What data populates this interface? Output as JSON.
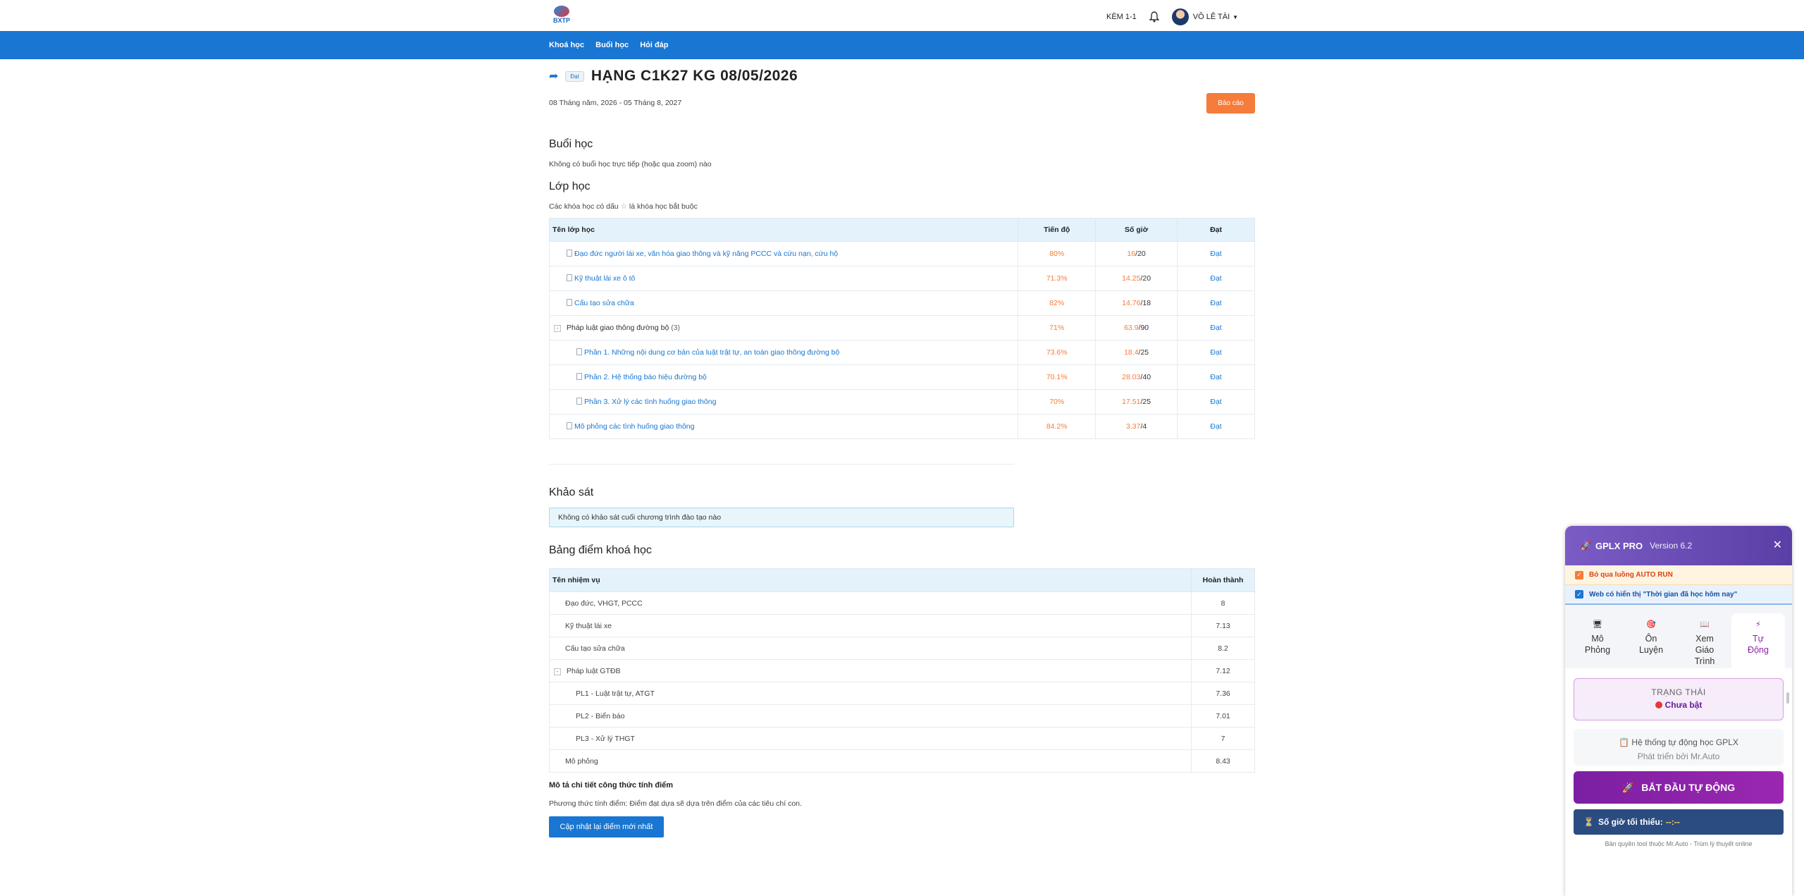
{
  "header": {
    "logo_text": "BXTP",
    "kem_label": "KÈM 1-1",
    "user_name": "VÕ LÊ TÀI"
  },
  "nav": [
    "Khoá học",
    "Buổi học",
    "Hỏi đáp"
  ],
  "course": {
    "status": "Đạt",
    "title": "HẠNG C1K27 KG 08/05/2026",
    "date_range": "08 Tháng năm, 2026 - 05 Tháng 8, 2027",
    "report_label": "Báo cáo"
  },
  "sessions": {
    "heading": "Buổi học",
    "note": "Không có buổi học trực tiếp (hoặc qua zoom) nào"
  },
  "classes": {
    "heading": "Lớp học",
    "note_before": "Các khóa học có dấu",
    "note_star": "☆",
    "note_after": "là khóa học bắt buộc",
    "columns": [
      "Tên lớp học",
      "Tiến độ",
      "Số giờ",
      "Đạt"
    ],
    "rows": [
      {
        "name": "Đạo đức người lái xe, văn hóa giao thông và kỹ năng PCCC và cứu nạn, cứu hộ",
        "progress": "80%",
        "hours_done": "16",
        "hours_total": "/20",
        "result": "Đạt"
      },
      {
        "name": "Kỹ thuật lái xe ô tô",
        "progress": "71.3%",
        "hours_done": "14.25",
        "hours_total": "/20",
        "result": "Đạt"
      },
      {
        "name": "Cấu tạo sửa chữa",
        "progress": "82%",
        "hours_done": "14.76",
        "hours_total": "/18",
        "result": "Đạt"
      },
      {
        "name": "Pháp luật giao thông đường bộ",
        "count": "(3)",
        "progress": "71%",
        "hours_done": "63.9",
        "hours_total": "/90",
        "result": "Đạt"
      },
      {
        "name": "Phần 1. Những nội dung cơ bản của luật trật tự, an toàn giao thông đường bộ",
        "progress": "73.6%",
        "hours_done": "18.4",
        "hours_total": "/25",
        "result": "Đạt"
      },
      {
        "name": "Phần 2. Hệ thống báo hiệu đường bộ",
        "progress": "70.1%",
        "hours_done": "28.03",
        "hours_total": "/40",
        "result": "Đạt"
      },
      {
        "name": "Phần 3. Xử lý các tình huống giao thông",
        "progress": "70%",
        "hours_done": "17.51",
        "hours_total": "/25",
        "result": "Đạt"
      },
      {
        "name": "Mô phỏng các tình huống giao thông",
        "progress": "84.2%",
        "hours_done": "3.37",
        "hours_total": "/4",
        "result": "Đạt"
      }
    ]
  },
  "survey": {
    "heading": "Khảo sát",
    "note": "Không có khảo sát cuối chương trình đào tạo nào"
  },
  "grades": {
    "heading": "Bảng điểm khoá học",
    "columns": [
      "Tên nhiệm vụ",
      "Hoàn thành"
    ],
    "rows": [
      {
        "name": "Đạo đức, VHGT, PCCC",
        "score": "8"
      },
      {
        "name": "Kỹ thuật lái xe",
        "score": "7.13"
      },
      {
        "name": "Cấu tạo sửa chữa",
        "score": "8.2"
      },
      {
        "name": "Pháp luật GTĐB",
        "score": "7.12"
      },
      {
        "name": "PL1 - Luật trật tự, ATGT",
        "score": "7.36"
      },
      {
        "name": "PL2 - Biển báo",
        "score": "7.01"
      },
      {
        "name": "PL3 - Xử lý THGT",
        "score": "7"
      },
      {
        "name": "Mô phỏng",
        "score": "8.43"
      }
    ],
    "formula_title": "Mô tả chi tiết công thức tính điểm",
    "formula_text": "Phương thức tính điểm: Điểm đạt dựa sẽ dựa trên điểm của các tiêu chí con.",
    "update_label": "Cập nhật lại điểm mới nhất"
  },
  "panel": {
    "brand": "GPLX PRO",
    "version": "Version 6.2",
    "option1": "Bỏ qua luồng AUTO RUN",
    "option2": "Web có hiển thị \"Thời gian đã học hôm nay\"",
    "tabs": [
      {
        "icon": "🖥",
        "line1": "Mô",
        "line2": "Phỏng",
        "line3": ""
      },
      {
        "icon": "🎯",
        "line1": "Ôn",
        "line2": "Luyện",
        "line3": ""
      },
      {
        "icon": "📖",
        "line1": "Xem",
        "line2": "Giáo",
        "line3": "Trình"
      },
      {
        "icon": "⚡",
        "line1": "Tự",
        "line2": "Động",
        "line3": ""
      }
    ],
    "status_label": "TRẠNG THÁI",
    "status_value": "Chưa bật",
    "system_title": "Hệ thống tự động học GPLX",
    "system_sub": "Phát triển bởi Mr.Auto",
    "start_label": "BẮT ĐẦU TỰ ĐỘNG",
    "min_hours_label": "Số giờ tối thiểu:",
    "min_hours_value": "--:--",
    "footer": "Bản quyền tool thuộc Mr.Auto - Trùm lý thuyết online"
  }
}
